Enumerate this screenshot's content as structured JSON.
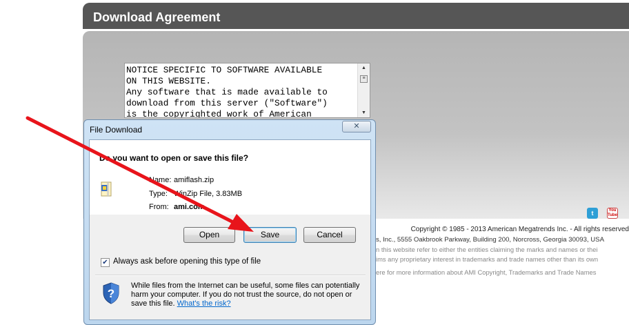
{
  "page": {
    "header_title": "Download Agreement",
    "license_lines": [
      "NOTICE SPECIFIC TO SOFTWARE AVAILABLE",
      "ON THIS WEBSITE.",
      "Any software that is made available to",
      "download from this server (\"Software\")",
      "is the copyrighted work of American"
    ],
    "footer": {
      "copyright": "Copyright © 1985 - 2013 American Megatrends Inc. - All rights reserved",
      "address": "s, Inc., 5555 Oakbrook Parkway, Building 200, Norcross, Georgia 30093, USA",
      "line3": "n this website refer to either the entities claiming the marks and names or thei",
      "line4": "ims any proprietary interest in trademarks and trade names other than its own",
      "line5": "ere for more information about AMI Copyright, Trademarks and Trade Names"
    },
    "social": {
      "twitter": "t",
      "youtube": "You Tube"
    }
  },
  "dialog": {
    "title": "File Download",
    "close_glyph": "✕",
    "question": "Do you want to open or save this file?",
    "name_label": "Name:",
    "name_value": "amiflash.zip",
    "type_label": "Type:",
    "type_value": "WinZip File, 3.83MB",
    "from_label": "From:",
    "from_value": "ami.com",
    "buttons": {
      "open": "Open",
      "save": "Save",
      "cancel": "Cancel"
    },
    "always_ask_label": "Always ask before opening this type of file",
    "always_ask_checked": true,
    "warning_text": "While files from the Internet can be useful, some files can potentially harm your computer. If you do not trust the source, do not open or save this file.",
    "risk_link": "What's the risk?"
  },
  "colors": {
    "header_bg": "#565656",
    "arrow": "#e8141b",
    "link": "#0066cc",
    "dialog_frame": "#bcd6ee"
  }
}
